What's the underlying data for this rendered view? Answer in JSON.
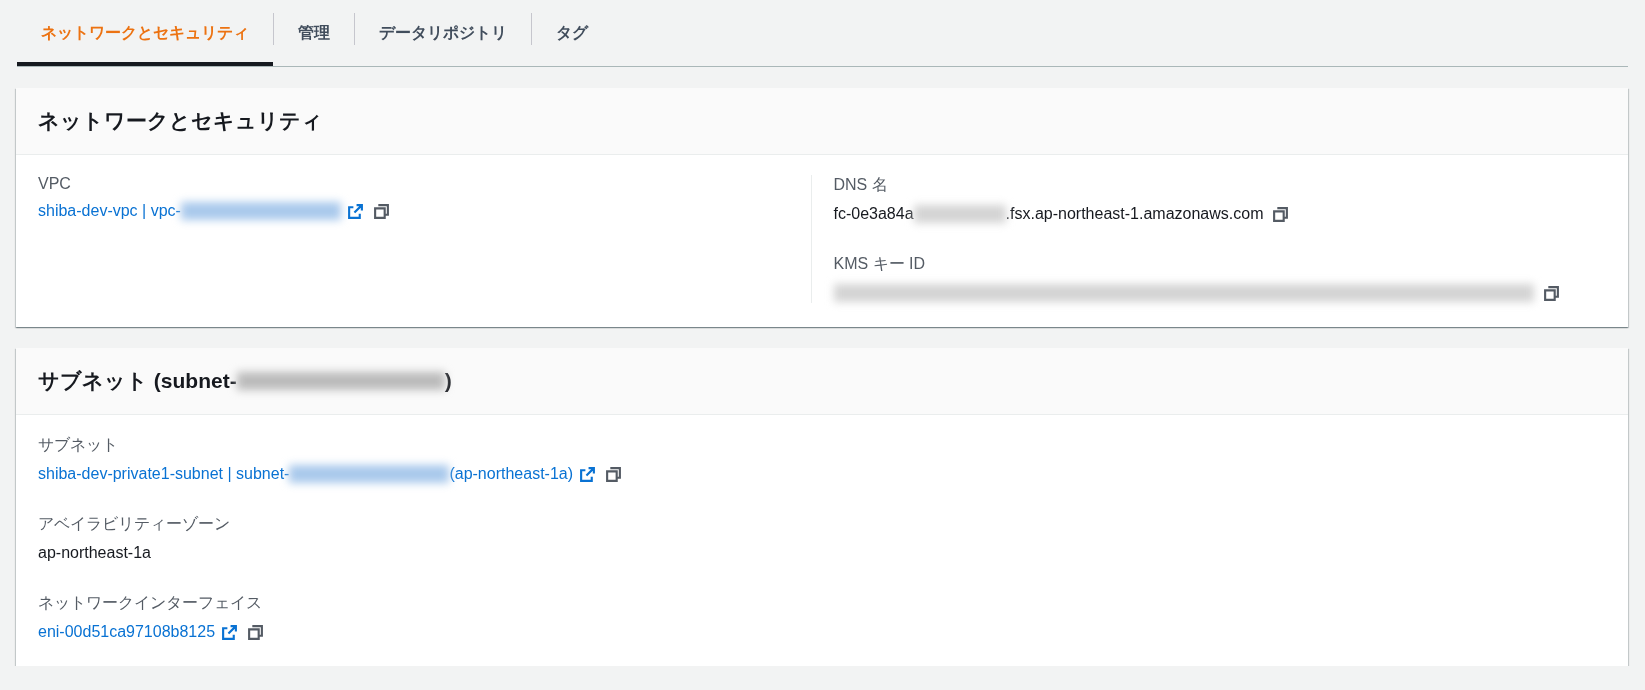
{
  "tabs": [
    {
      "label": "ネットワークとセキュリティ",
      "selected": true
    },
    {
      "label": "管理",
      "selected": false
    },
    {
      "label": "データリポジトリ",
      "selected": false
    },
    {
      "label": "タグ",
      "selected": false
    }
  ],
  "sections": [
    {
      "title": [
        {
          "kind": "text",
          "text": "ネットワークとセキュリティ"
        }
      ],
      "columns": [
        [
          {
            "label": "VPC",
            "link": true,
            "external_link": true,
            "copy_button": true,
            "value": [
              {
                "kind": "text",
                "text": "shiba-dev-vpc | vpc-"
              },
              {
                "kind": "redacted"
              }
            ]
          }
        ],
        [
          {
            "label": "DNS 名",
            "link": false,
            "external_link": false,
            "copy_button": true,
            "value": [
              {
                "kind": "text",
                "text": "fc-0e3a84a"
              },
              {
                "kind": "redacted-short"
              },
              {
                "kind": "text",
                "text": ".fsx.ap-northeast-1.amazonaws.com"
              }
            ]
          },
          {
            "label": "KMS キー ID",
            "link": false,
            "external_link": false,
            "copy_button": true,
            "value": [
              {
                "kind": "redacted-long"
              }
            ]
          }
        ]
      ]
    },
    {
      "title": [
        {
          "kind": "text",
          "text": "サブネット (subnet-"
        },
        {
          "kind": "redacted-wide"
        },
        {
          "kind": "text",
          "text": ")"
        }
      ],
      "columns": [
        [
          {
            "label": "サブネット",
            "link": true,
            "external_link": true,
            "copy_button": true,
            "value": [
              {
                "kind": "text",
                "text": "shiba-dev-private1-subnet | subnet-"
              },
              {
                "kind": "redacted"
              },
              {
                "kind": "text",
                "text": " (ap-northeast-1a)"
              }
            ]
          },
          {
            "label": "アベイラビリティーゾーン",
            "link": false,
            "external_link": false,
            "copy_button": false,
            "value": [
              {
                "kind": "text",
                "text": "ap-northeast-1a"
              }
            ]
          },
          {
            "label": "ネットワークインターフェイス",
            "link": true,
            "external_link": true,
            "copy_button": true,
            "value": [
              {
                "kind": "text",
                "text": "eni-00d51ca97108b8125"
              }
            ]
          }
        ]
      ]
    }
  ]
}
